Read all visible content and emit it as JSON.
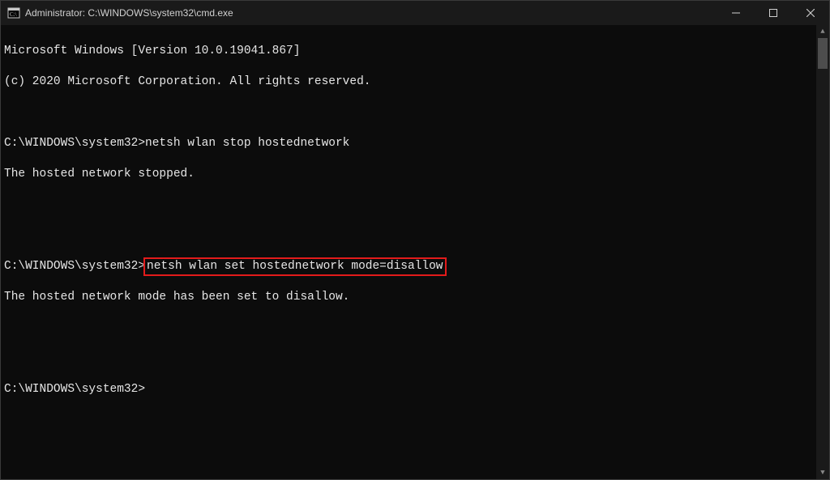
{
  "window": {
    "title": "Administrator: C:\\WINDOWS\\system32\\cmd.exe"
  },
  "terminal": {
    "header1": "Microsoft Windows [Version 10.0.19041.867]",
    "header2": "(c) 2020 Microsoft Corporation. All rights reserved.",
    "prompt": "C:\\WINDOWS\\system32>",
    "cmd1": "netsh wlan stop hostednetwork",
    "out1": "The hosted network stopped.",
    "cmd2": "netsh wlan set hostednetwork mode=disallow",
    "out2": "The hosted network mode has been set to disallow."
  }
}
